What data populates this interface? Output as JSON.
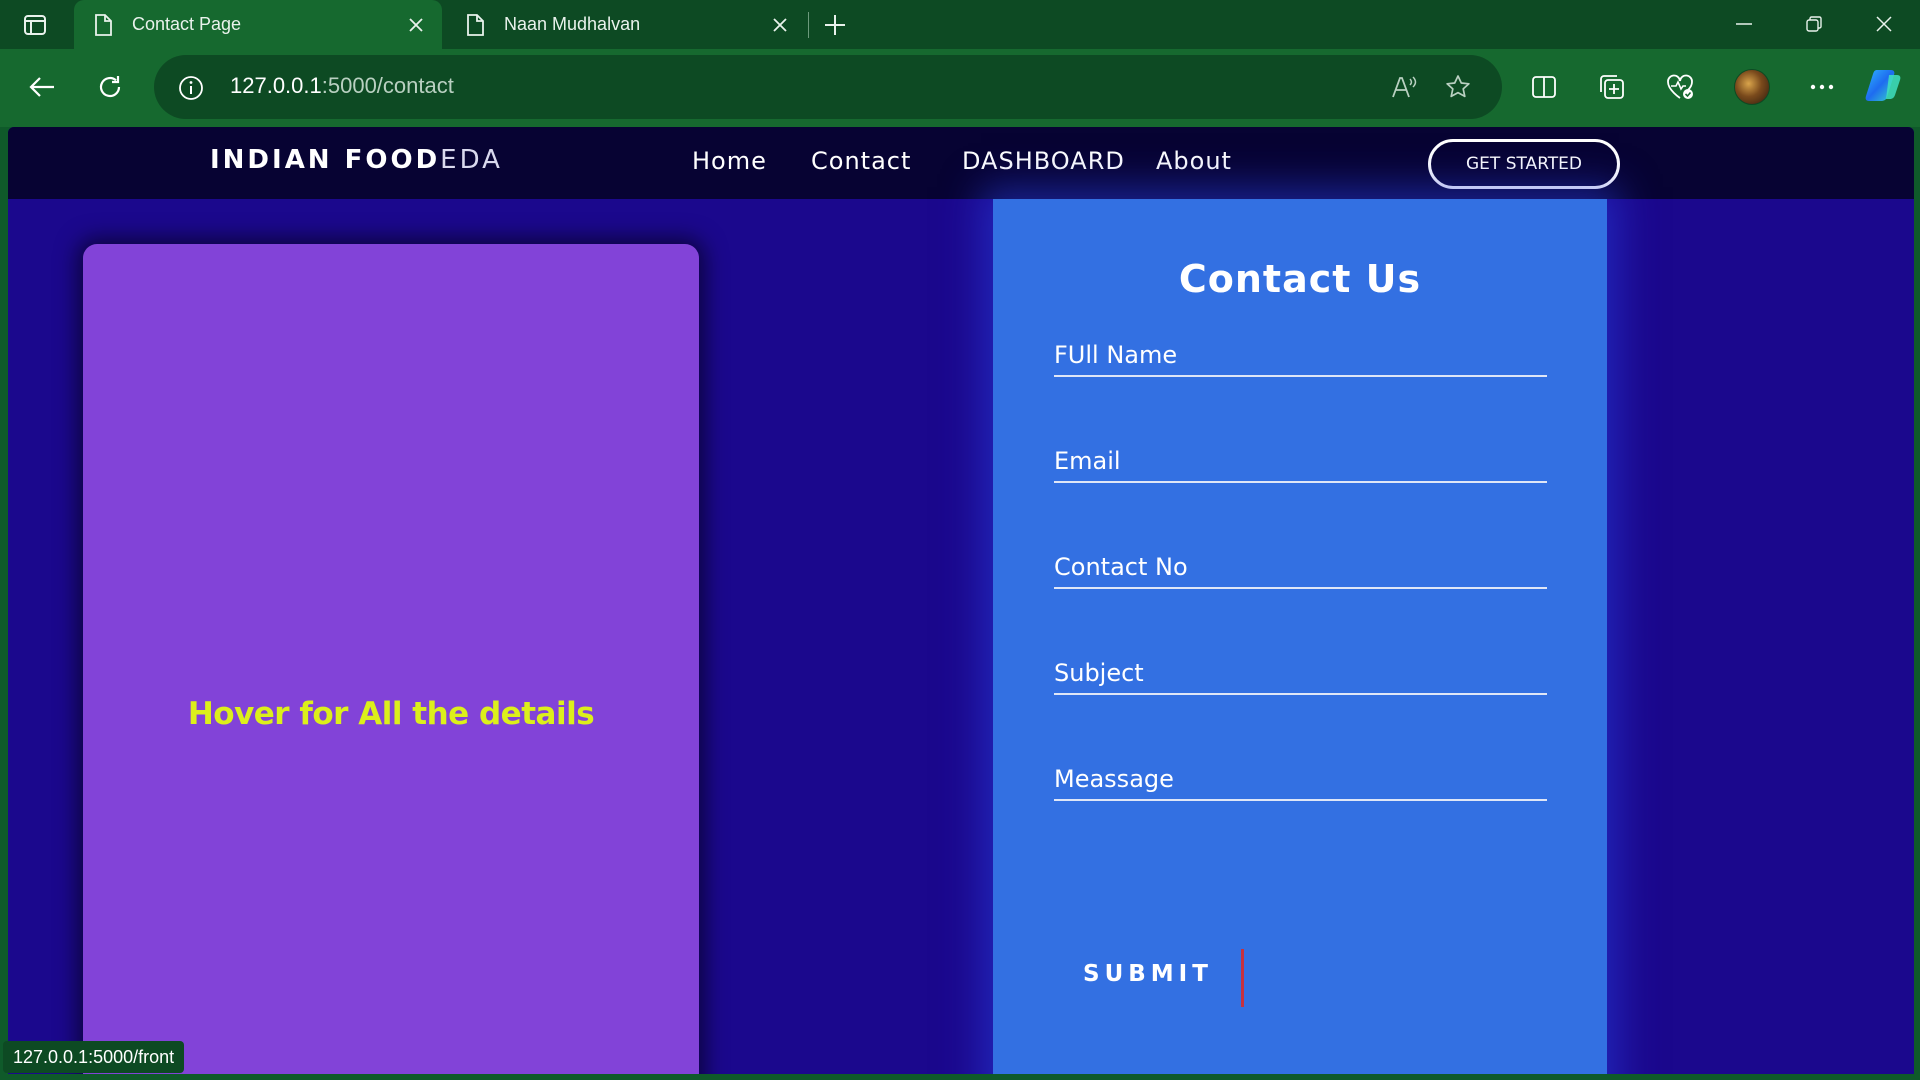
{
  "browser": {
    "tabs": [
      {
        "title": "Contact Page",
        "active": true
      },
      {
        "title": "Naan Mudhalvan",
        "active": false
      }
    ],
    "url_host": "127.0.0.1",
    "url_rest": ":5000/contact",
    "status_url": "127.0.0.1:5000/front",
    "icons": [
      "tab-actions-icon",
      "document-icon",
      "close-icon",
      "new-tab-icon",
      "minimize-icon",
      "restore-icon",
      "window-close-icon",
      "back-icon",
      "refresh-icon",
      "info-icon",
      "read-aloud-icon",
      "favorite-star-icon",
      "split-screen-icon",
      "collections-icon",
      "browser-essentials-icon",
      "profile-avatar",
      "more-icon",
      "copilot-icon"
    ]
  },
  "site": {
    "brand_bold": "INDIAN FOOD",
    "brand_light": "EDA",
    "nav": [
      "Home",
      "Contact",
      "DASHBOARD",
      "About"
    ],
    "cta": "GET STARTED",
    "hover_text": "Hover for All the details",
    "form": {
      "title": "Contact Us",
      "fields": [
        {
          "name": "full-name",
          "placeholder": "FUll Name"
        },
        {
          "name": "email",
          "placeholder": "Email"
        },
        {
          "name": "contact-no",
          "placeholder": "Contact No"
        },
        {
          "name": "subject",
          "placeholder": "Subject"
        },
        {
          "name": "message",
          "placeholder": "Meassage"
        }
      ],
      "submit": "SUBMIT"
    }
  },
  "colors": {
    "page_bg": "#1b088d",
    "navbar_bg": "#070333",
    "hover_card": "#8243d8",
    "hover_text": "#dcef1b",
    "form_panel": "#3370e2",
    "browser_frame": "#16692f"
  }
}
